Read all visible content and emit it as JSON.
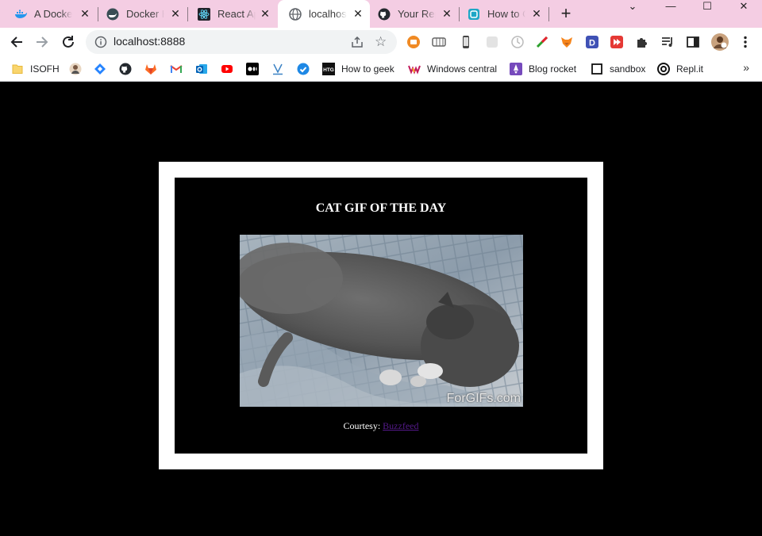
{
  "browser": {
    "tabs": [
      {
        "title": "A Docker",
        "icon": "docker-whale-icon"
      },
      {
        "title": "Docker H",
        "icon": "docker-hub-icon"
      },
      {
        "title": "React App",
        "icon": "react-icon"
      },
      {
        "title": "localhost",
        "icon": "globe-icon",
        "active": true
      },
      {
        "title": "Your Rep",
        "icon": "github-icon"
      },
      {
        "title": "How to C",
        "icon": "repl-square-icon"
      }
    ],
    "address": "localhost:8888",
    "bookmarks": [
      {
        "label": "ISOFH",
        "icon": "folder-icon"
      },
      {
        "label": "",
        "icon": "avatar-icon"
      },
      {
        "label": "",
        "icon": "jira-diamond-icon"
      },
      {
        "label": "",
        "icon": "github-icon"
      },
      {
        "label": "",
        "icon": "gitlab-icon"
      },
      {
        "label": "",
        "icon": "gmail-icon"
      },
      {
        "label": "",
        "icon": "outlook-icon"
      },
      {
        "label": "",
        "icon": "youtube-icon"
      },
      {
        "label": "",
        "icon": "medium-icon"
      },
      {
        "label": "",
        "icon": "v-underline-icon"
      },
      {
        "label": "",
        "icon": "check-circle-icon"
      },
      {
        "label": "How to geek",
        "icon": "htg-icon"
      },
      {
        "label": "Windows central",
        "icon": "windows-central-icon"
      },
      {
        "label": "Blog rocket",
        "icon": "rocket-icon"
      },
      {
        "label": "sandbox",
        "icon": "sandbox-icon"
      },
      {
        "label": "Repl.it",
        "icon": "replit-icon"
      }
    ],
    "more_bookmarks": "»"
  },
  "page": {
    "heading": "CAT GIF OF THE DAY",
    "gif_watermark": "ForGIFs.com",
    "courtesy_label": "Courtesy:",
    "courtesy_link": "Buzzfeed"
  },
  "colors": {
    "tabstrip": "#f4cde3",
    "page_bg": "#000000",
    "frame": "#ffffff",
    "visited_link": "#551a8b"
  }
}
